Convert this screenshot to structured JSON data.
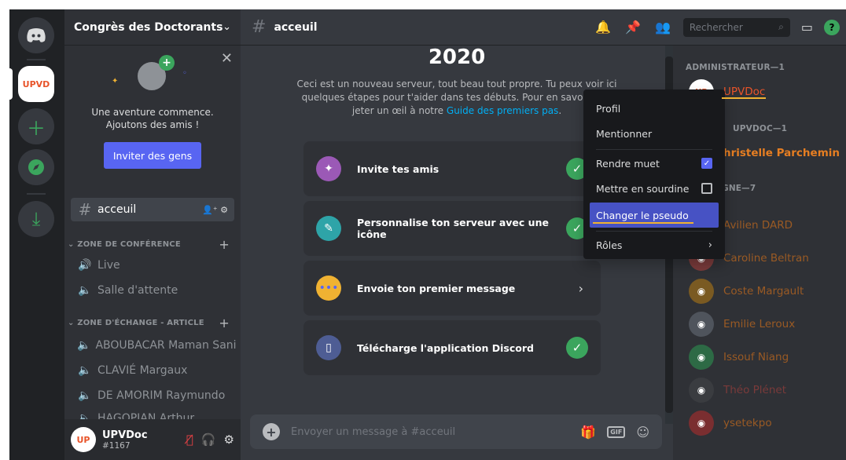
{
  "server": {
    "name": "Congrès des Doctorants ...",
    "rail_icon_label": "UPVD"
  },
  "welcome": {
    "line1": "Une aventure commence.",
    "line2": "Ajoutons des amis !",
    "invite_button": "Inviter des gens"
  },
  "channels": {
    "active": "acceuil",
    "categories": [
      {
        "name": "ZONE DE CONFÉRENCE",
        "items": [
          "Live",
          "Salle d'attente"
        ]
      },
      {
        "name": "ZONE D'ÉCHANGE - ARTICLE",
        "items": [
          "ABOUBACAR Maman Sani",
          "CLAVIÉ Margaux",
          "DE AMORIM Raymundo",
          "HAGOPIAN Arthur"
        ]
      }
    ]
  },
  "user": {
    "name": "UPVDoc",
    "tag": "#1167"
  },
  "topbar": {
    "channel": "acceuil",
    "search_placeholder": "Rechercher"
  },
  "main": {
    "year": "2020",
    "intro_line1": "Ceci est un nouveau serveur, tout beau tout propre. Tu peux voir ici",
    "intro_line2": "quelques étapes pour t'aider dans tes débuts. Pour en savoir plus",
    "intro_line3_prefix": "jeter un œil à notre ",
    "intro_link": "Guide des premiers pas",
    "intro_line3_suffix": ".",
    "cards": [
      {
        "label": "Invite tes amis",
        "status": "done"
      },
      {
        "label": "Personnalise ton serveur avec une icône",
        "status": "done"
      },
      {
        "label": "Envoie ton premier message",
        "status": "todo"
      },
      {
        "label": "Télécharge l'application Discord",
        "status": "done"
      }
    ],
    "composer_placeholder": "Envoyer un message à #acceuil",
    "gif_label": "GIF"
  },
  "members": {
    "groups": [
      {
        "name": "ADMINISTRATEUR—1",
        "members": [
          {
            "name": "UPVDoc",
            "color": "#e8542a"
          }
        ]
      },
      {
        "name": "UPVDOC—1",
        "members": [
          {
            "name": "Christelle Parchemin",
            "color": "#e67e22"
          }
        ]
      },
      {
        "name": "GNE—7",
        "members": [
          {
            "name": "Avilien DARD",
            "color": "#e67e22"
          },
          {
            "name": "Caroline Beltran",
            "color": "#e67e22"
          },
          {
            "name": "Coste Margault",
            "color": "#e67e22"
          },
          {
            "name": "Emilie Leroux",
            "color": "#e67e22"
          },
          {
            "name": "Issouf Niang",
            "color": "#e67e22"
          },
          {
            "name": "Théo Plénet",
            "color": "#e67e22"
          },
          {
            "name": "ysetekpo",
            "color": "#e67e22"
          }
        ]
      }
    ]
  },
  "context_menu": {
    "items": [
      "Profil",
      "Mentionner",
      "Rendre muet",
      "Mettre en sourdine",
      "Changer le pseudo",
      "Rôles"
    ],
    "rendre_muet_checked": true,
    "sourdine_checked": false,
    "highlighted": "Changer le pseudo"
  },
  "colors": {
    "accent": "#5865f2",
    "success": "#3ba55d",
    "link": "#00aff4",
    "member_orange": "#e67e22",
    "annotation_underline": "#f0b232"
  }
}
